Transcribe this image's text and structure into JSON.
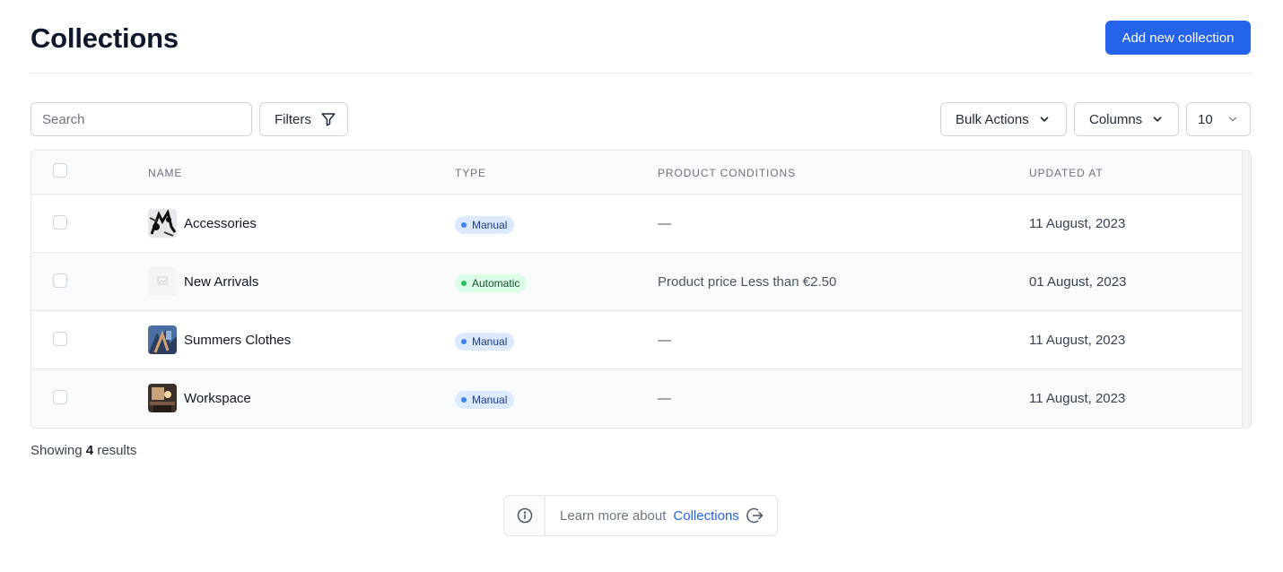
{
  "header": {
    "title": "Collections",
    "add_button": "Add new collection"
  },
  "toolbar": {
    "search_placeholder": "Search",
    "filters_label": "Filters",
    "bulk_actions_label": "Bulk Actions",
    "columns_label": "Columns",
    "per_page": "10"
  },
  "table": {
    "headers": {
      "name": "Name",
      "type": "Type",
      "conditions": "Product conditions",
      "updated": "Updated at"
    },
    "rows": [
      {
        "name": "Accessories",
        "type": "Manual",
        "conditions": "—",
        "updated": "11 August, 2023"
      },
      {
        "name": "New Arrivals",
        "type": "Automatic",
        "conditions": "Product price Less than €2.50",
        "updated": "01 August, 2023"
      },
      {
        "name": "Summers Clothes",
        "type": "Manual",
        "conditions": "—",
        "updated": "11 August, 2023"
      },
      {
        "name": "Workspace",
        "type": "Manual",
        "conditions": "—",
        "updated": "11 August, 2023"
      }
    ]
  },
  "footer": {
    "showing_prefix": "Showing",
    "count": "4",
    "showing_suffix": "results"
  },
  "learn_more": {
    "text": "Learn more about",
    "link": "Collections"
  },
  "colors": {
    "primary": "#2563eb",
    "manual_badge_bg": "#dbeafe",
    "automatic_badge_bg": "#dcfce7"
  },
  "icons": [
    "filter-icon",
    "chevron-down-icon",
    "info-icon",
    "arrow-right-circle-icon"
  ]
}
